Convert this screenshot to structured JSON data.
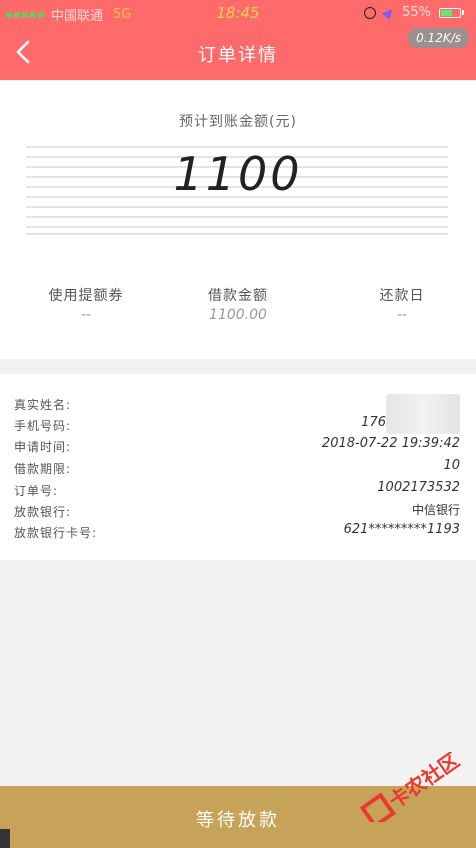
{
  "status_bar": {
    "carrier": "中国联通",
    "network": "5G",
    "time": "18:45",
    "battery": "55%"
  },
  "nav": {
    "title": "订单详情",
    "speed": "0.12K/s"
  },
  "amount": {
    "label": "预计到账金额(元)",
    "value": "1100"
  },
  "stats": [
    {
      "label": "使用提额券",
      "value": "--"
    },
    {
      "label": "借款金额",
      "value": "1100.00"
    },
    {
      "label": "还款日",
      "value": "--"
    }
  ],
  "info": {
    "real_name": {
      "label": "真实姓名:",
      "value": ""
    },
    "phone": {
      "label": "手机号码:",
      "value": "176"
    },
    "apply_time": {
      "label": "申请时间:",
      "value": "2018-07-22 19:39:42"
    },
    "term": {
      "label": "借款期限:",
      "value": "10"
    },
    "order_no": {
      "label": "订单号:",
      "value": "1002173532"
    },
    "bank": {
      "label": "放款银行:",
      "value": "中信银行"
    },
    "card_no": {
      "label": "放款银行卡号:",
      "value": "621*********1193"
    }
  },
  "bottom": {
    "label": "等待放款"
  },
  "watermark": {
    "text": "卡农社区"
  },
  "colors": {
    "header": "#ff6b6b",
    "button": "#c6a359"
  }
}
